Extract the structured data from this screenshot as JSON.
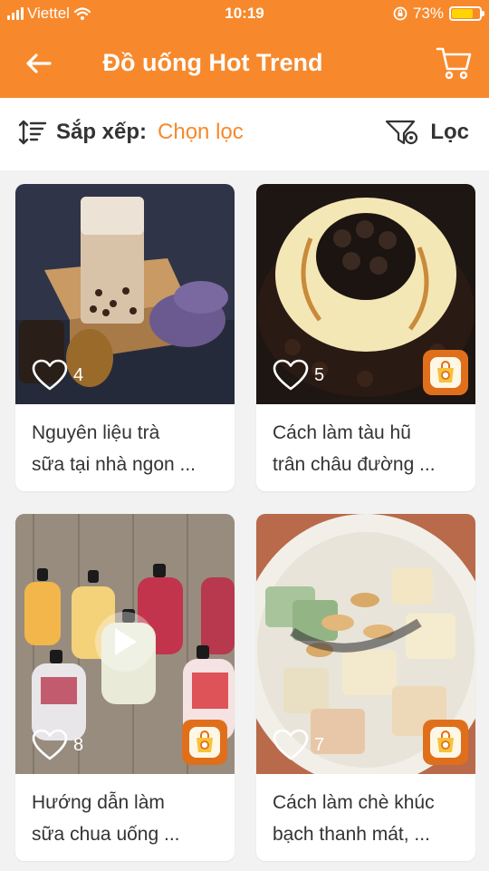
{
  "status_bar": {
    "carrier": "Viettel",
    "time": "10:19",
    "battery": "73%",
    "battery_level": 0.73
  },
  "header": {
    "title": "Đồ uống Hot Trend"
  },
  "sort": {
    "label": "Sắp xếp:",
    "value": "Chọn lọc"
  },
  "filter": {
    "label": "Lọc"
  },
  "colors": {
    "accent": "#f7892c",
    "background": "#f2f2f2",
    "text": "#333333"
  },
  "cards": [
    {
      "likes": "4",
      "title_line1": "Nguyên liệu trà",
      "title_line2": "sữa tại nhà ngon ...",
      "has_badge": false,
      "has_video": false
    },
    {
      "likes": "5",
      "title_line1": "Cách làm tàu hũ",
      "title_line2": "trân châu đường ...",
      "has_badge": true,
      "has_video": false
    },
    {
      "likes": "8",
      "title_line1": "Hướng dẫn làm",
      "title_line2": "sữa chua uống ...",
      "has_badge": true,
      "has_video": true
    },
    {
      "likes": "7",
      "title_line1": "Cách làm chè khúc",
      "title_line2": "bạch thanh mát, ...",
      "has_badge": true,
      "has_video": false
    }
  ]
}
